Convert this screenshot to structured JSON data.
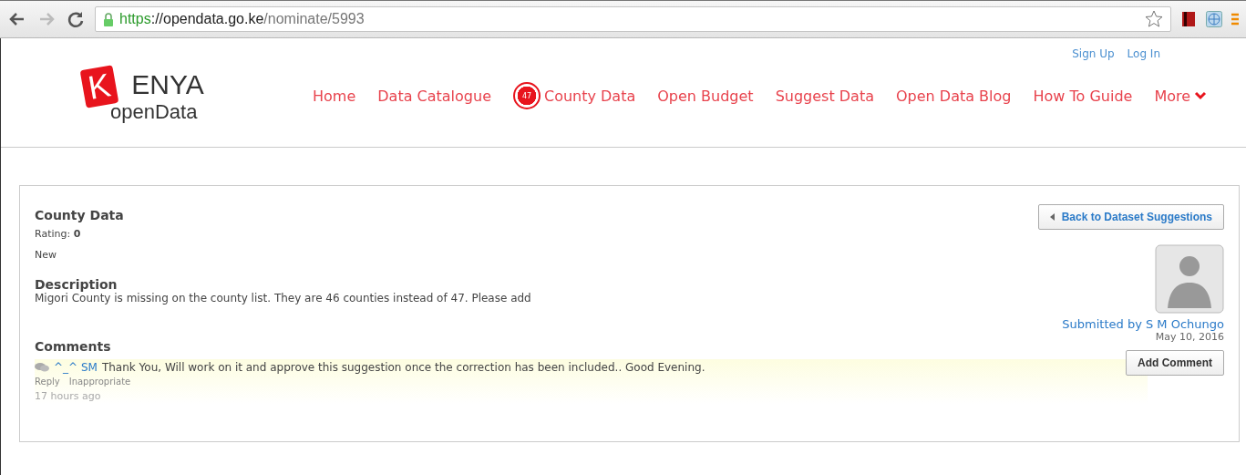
{
  "browser": {
    "url_scheme": "https",
    "url_host": "://opendata.go.ke",
    "url_path": "/nominate/5993"
  },
  "header": {
    "top_links": [
      "Sign Up",
      "Log In"
    ],
    "logo": {
      "initial": "K",
      "rest": "ENYA",
      "sub": "openData"
    },
    "nav": [
      {
        "label": "Home",
        "kind": "link"
      },
      {
        "label": "Data Catalogue",
        "kind": "link"
      },
      {
        "label": "County Data",
        "kind": "badge",
        "badge": "47"
      },
      {
        "label": "Open Budget",
        "kind": "link"
      },
      {
        "label": "Suggest Data",
        "kind": "link"
      },
      {
        "label": "Open Data Blog",
        "kind": "link"
      },
      {
        "label": "How To Guide",
        "kind": "link"
      },
      {
        "label": "More",
        "kind": "menu"
      }
    ]
  },
  "suggestion": {
    "title": "County Data",
    "rating_label": "Rating:",
    "rating": "0",
    "status": "New",
    "description_heading": "Description",
    "description": "Migori County is missing on the county list. They are 46 counties instead of 47. Please add",
    "comments_heading": "Comments",
    "back_button": "Back to Dataset Suggestions",
    "submitted_by": "Submitted by S M Ochungo",
    "date": "May 10, 2016",
    "add_comment_button": "Add Comment",
    "comments": [
      {
        "author": "^_^ SM",
        "text": "Thank You, Will work on it and approve this suggestion once the correction has been included.. Good Evening.",
        "actions": [
          "Reply",
          "Inappropriate"
        ],
        "time": "17 hours ago"
      }
    ]
  }
}
